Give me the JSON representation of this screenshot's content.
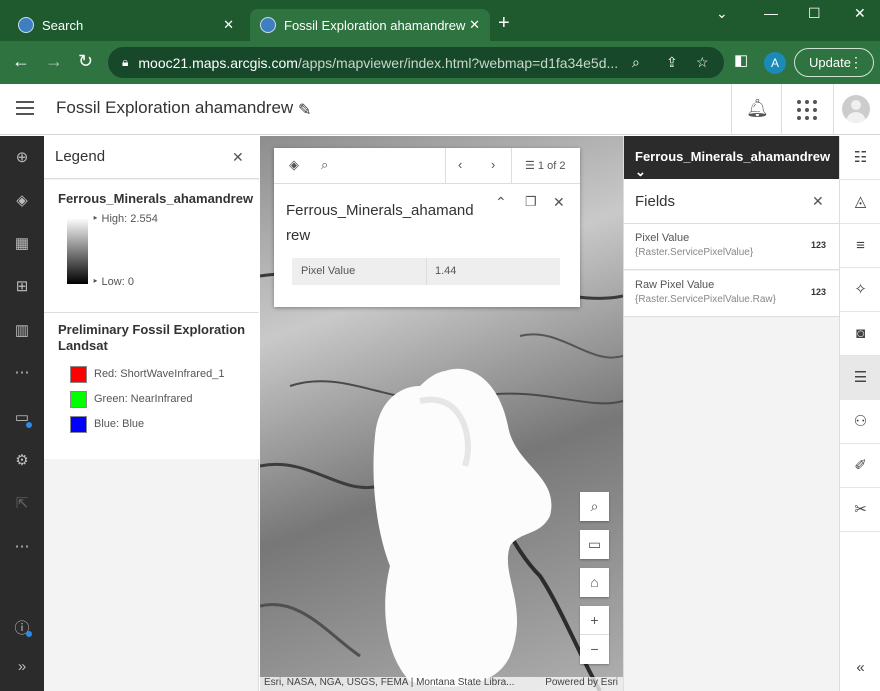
{
  "browser": {
    "tabs": [
      {
        "title": "Search",
        "close": "✕"
      },
      {
        "title": "Fossil Exploration ahamandrew",
        "close": "✕"
      }
    ],
    "new_tab": "+",
    "url_host": "mooc21.maps.arcgis.com",
    "url_path": "/apps/mapviewer/index.html?webmap=d1fa34e5d...",
    "profile_initial": "A",
    "update_label": "Update"
  },
  "app": {
    "title": "Fossil Exploration ahamandrew"
  },
  "legend": {
    "title": "Legend",
    "layer1": {
      "name": "Ferrous_Minerals_ahamandrew",
      "high": "High: 2.554",
      "low": "Low: 0"
    },
    "layer2": {
      "name": "Preliminary Fossil Exploration Landsat",
      "bands": [
        {
          "label": "Red: ShortWaveInfrared_1",
          "color": "#ff0000"
        },
        {
          "label": "Green: NearInfrared",
          "color": "#00ff00"
        },
        {
          "label": "Blue: Blue",
          "color": "#0000ff"
        }
      ]
    }
  },
  "popup": {
    "pager": "1 of 2",
    "title": "Ferrous_Minerals_ahamandrew",
    "field": "Pixel Value",
    "value": "1.44"
  },
  "map": {
    "attribution": "Esri, NASA, NGA, USGS, FEMA | Montana State Libra...",
    "powered_by": "Powered by Esri"
  },
  "fields_panel": {
    "layer": "Ferrous_Minerals_ahamandrew",
    "title": "Fields",
    "rows": [
      {
        "name": "Pixel Value",
        "expr": "{Raster.ServicePixelValue}",
        "type": "123"
      },
      {
        "name": "Raw Pixel Value",
        "expr": "{Raster.ServicePixelValue.Raw}",
        "type": "123"
      }
    ]
  }
}
